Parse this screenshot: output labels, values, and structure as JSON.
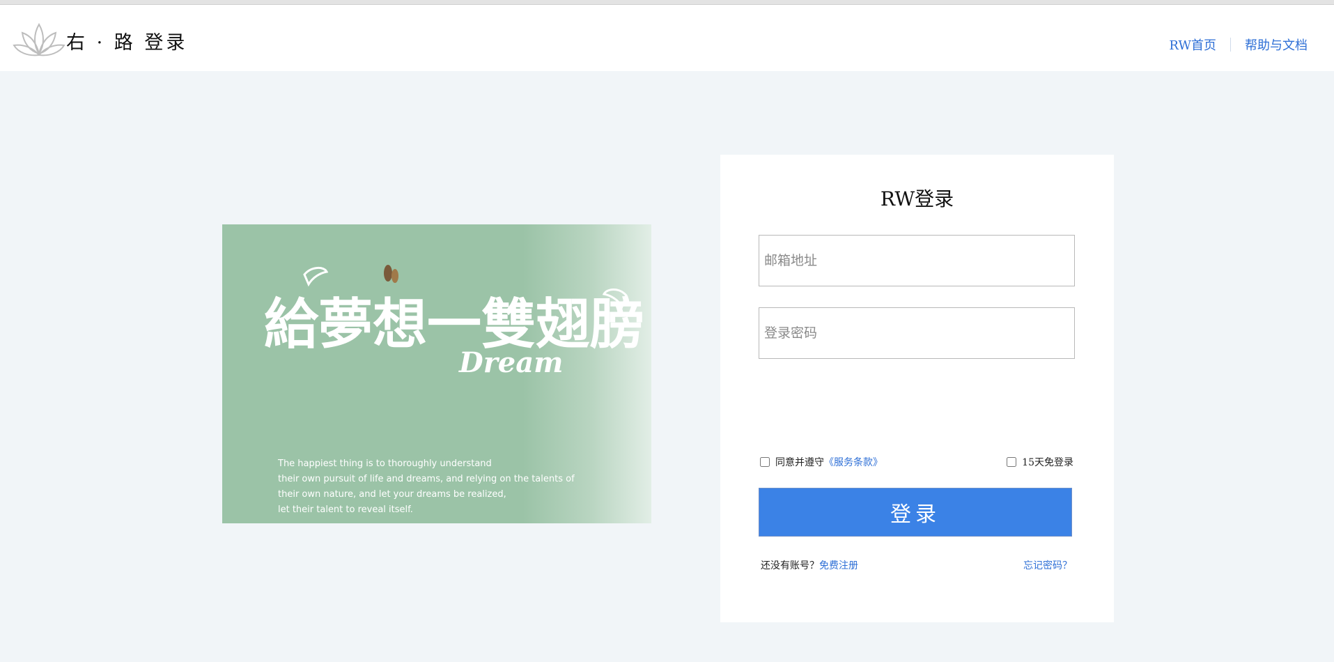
{
  "header": {
    "brand": "右 · 路 登录",
    "nav": [
      "RW首页",
      "帮助与文档"
    ]
  },
  "banner": {
    "calligraphy": "給夢想一雙翅膀",
    "dream": "Dream",
    "quote_lines": [
      "The happiest thing is to thoroughly understand",
      "their own pursuit of life and dreams, and relying on the talents of",
      "their own nature, and let your dreams be realized,",
      "let their talent to reveal itself."
    ]
  },
  "login": {
    "title": "RW登录",
    "email_placeholder": "邮箱地址",
    "password_placeholder": "登录密码",
    "agree_text": "同意并遵守",
    "terms_link": "《服务条款》",
    "remember_label": "15天免登录",
    "button_label": "登录",
    "no_account_text": "还没有账号？",
    "register_link": "免费注册",
    "forgot_link": "忘记密码？"
  },
  "colors": {
    "accent": "#3b82e6",
    "link": "#2e6fd6",
    "page_bg": "#f1f5f8",
    "banner_green": "#9bc3a7"
  }
}
